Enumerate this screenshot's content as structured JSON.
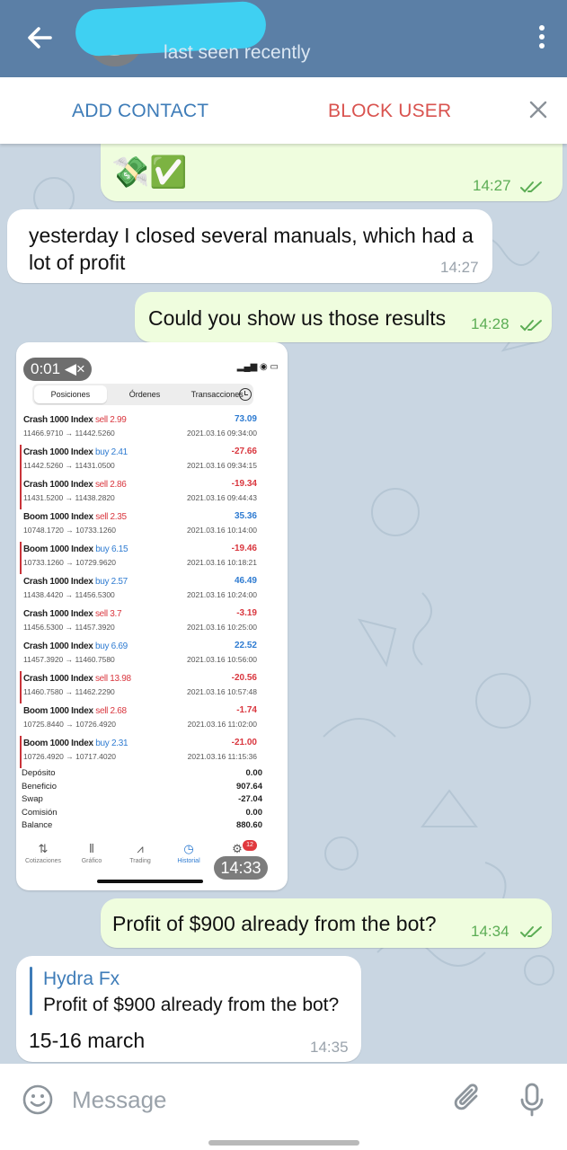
{
  "header": {
    "subtitle": "last seen recently",
    "back_icon": "arrow-left-icon",
    "menu_icon": "kebab-menu-icon"
  },
  "actionbar": {
    "add_contact": "ADD CONTACT",
    "block_user": "BLOCK USER"
  },
  "messages": {
    "m0": {
      "text": "💸✅",
      "time": "14:27"
    },
    "m1": {
      "text": "yesterday I closed several manuals, which had a lot of profit",
      "time": "14:27"
    },
    "m2": {
      "text": "Could you show us those results",
      "time": "14:28"
    },
    "m3": {
      "time": "14:33"
    },
    "m4": {
      "text": "Profit of $900 already from the bot?",
      "time": "14:34"
    },
    "m5": {
      "reply_name": "Hydra Fx",
      "reply_text": "Profit of $900 already from the bot?",
      "text": "15-16 march",
      "time": "14:35"
    }
  },
  "screenshot": {
    "rec_timer": "0:01",
    "tabs": [
      "Posiciones",
      "Órdenes",
      "Transacciones"
    ],
    "trades": [
      {
        "symbol": "Crash 1000 Index",
        "side": "sell",
        "lot": "2.99",
        "prices": "11466.9710 → 11442.5260",
        "pl": "73.09",
        "date": "2021.03.16 09:34:00",
        "neg": false
      },
      {
        "symbol": "Crash 1000 Index",
        "side": "buy",
        "lot": "2.41",
        "prices": "11442.5260 → 11431.0500",
        "pl": "-27.66",
        "date": "2021.03.16 09:34:15",
        "neg": true
      },
      {
        "symbol": "Crash 1000 Index",
        "side": "sell",
        "lot": "2.86",
        "prices": "11431.5200 → 11438.2820",
        "pl": "-19.34",
        "date": "2021.03.16 09:44:43",
        "neg": true
      },
      {
        "symbol": "Boom 1000 Index",
        "side": "sell",
        "lot": "2.35",
        "prices": "10748.1720 → 10733.1260",
        "pl": "35.36",
        "date": "2021.03.16 10:14:00",
        "neg": false
      },
      {
        "symbol": "Boom 1000 Index",
        "side": "buy",
        "lot": "6.15",
        "prices": "10733.1260 → 10729.9620",
        "pl": "-19.46",
        "date": "2021.03.16 10:18:21",
        "neg": true
      },
      {
        "symbol": "Crash 1000 Index",
        "side": "buy",
        "lot": "2.57",
        "prices": "11438.4420 → 11456.5300",
        "pl": "46.49",
        "date": "2021.03.16 10:24:00",
        "neg": false
      },
      {
        "symbol": "Crash 1000 Index",
        "side": "sell",
        "lot": "3.7",
        "prices": "11456.5300 → 11457.3920",
        "pl": "-3.19",
        "date": "2021.03.16 10:25:00",
        "neg": false
      },
      {
        "symbol": "Crash 1000 Index",
        "side": "buy",
        "lot": "6.69",
        "prices": "11457.3920 → 11460.7580",
        "pl": "22.52",
        "date": "2021.03.16 10:56:00",
        "neg": false
      },
      {
        "symbol": "Crash 1000 Index",
        "side": "sell",
        "lot": "13.98",
        "prices": "11460.7580 → 11462.2290",
        "pl": "-20.56",
        "date": "2021.03.16 10:57:48",
        "neg": true
      },
      {
        "symbol": "Boom 1000 Index",
        "side": "sell",
        "lot": "2.68",
        "prices": "10725.8440 → 10726.4920",
        "pl": "-1.74",
        "date": "2021.03.16 11:02:00",
        "neg": false
      },
      {
        "symbol": "Boom 1000 Index",
        "side": "buy",
        "lot": "2.31",
        "prices": "10726.4920 → 10717.4020",
        "pl": "-21.00",
        "date": "2021.03.16 11:15:36",
        "neg": true
      }
    ],
    "summary": [
      {
        "k": "Depósito",
        "v": "0.00"
      },
      {
        "k": "Beneficio",
        "v": "907.64"
      },
      {
        "k": "Swap",
        "v": "-27.04"
      },
      {
        "k": "Comisión",
        "v": "0.00"
      },
      {
        "k": "Balance",
        "v": "880.60"
      }
    ],
    "nav": [
      "Cotizaciones",
      "Gráfico",
      "Trading",
      "Historial"
    ],
    "badge": "12"
  },
  "input": {
    "placeholder": "Message"
  },
  "colors": {
    "header": "#5b7fa6",
    "outgoing_bubble": "#effdde",
    "incoming_bubble": "#ffffff",
    "chat_bg": "#c9d6e2",
    "link_blue": "#3e7cb8",
    "danger_red": "#d9534f"
  }
}
